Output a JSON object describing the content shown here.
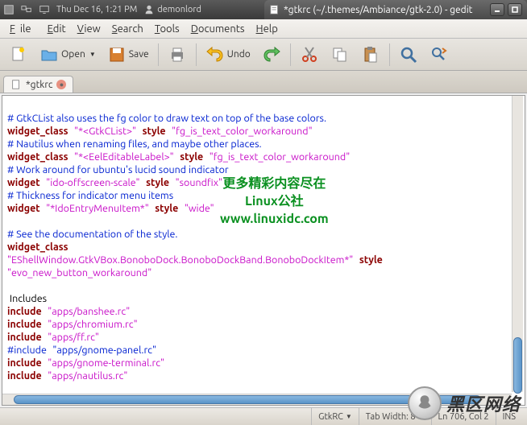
{
  "panel": {
    "date": "Thu Dec 16, 1:21 PM",
    "user": "demonlord"
  },
  "window": {
    "title": "*gtkrc (~/.themes/Ambiance/gtk-2.0) - gedit"
  },
  "menu": {
    "file": "File",
    "edit": "Edit",
    "view": "View",
    "search": "Search",
    "tools": "Tools",
    "documents": "Documents",
    "help": "Help"
  },
  "toolbar": {
    "open": "Open",
    "save": "Save",
    "undo": "Undo"
  },
  "tab": {
    "name": "*gtkrc"
  },
  "code": {
    "l1": "# GtkCList also uses the fg color to draw text on top of the base colors.",
    "l2a": "widget_class",
    "l2b": "\"*<GtkCList>\"",
    "l2c": "style",
    "l2d": "\"fg_is_text_color_workaround\"",
    "l3": "# Nautilus when renaming files, and maybe other places.",
    "l4a": "widget_class",
    "l4b": "\"*<EelEditableLabel>\"",
    "l4c": "style",
    "l4d": "\"fg_is_text_color_workaround\"",
    "l5": "# Work around for ubuntu's lucid sound indicator",
    "l6a": "widget",
    "l6b": "\"ido-offscreen-scale\"",
    "l6c": "style",
    "l6d": "\"soundfix\"",
    "l7": "# Thickness for indicator menu items",
    "l8a": "widget",
    "l8b": "\"*IdoEntryMenuItem*\"",
    "l8c": "style",
    "l8d": "\"wide\"",
    "l9": "",
    "l10": "# See the documentation of the style.",
    "l11a": "widget_class",
    "l12a": "\"EShellWindow.GtkVBox.BonoboDock.BonoboDockBand.BonoboDockItem*\"",
    "l12b": "style",
    "l13a": "\"evo_new_button_workaround\"",
    "l14": "",
    "l15": " Includes",
    "l16a": "include",
    "l16b": "\"apps/banshee.rc\"",
    "l17a": "include",
    "l17b": "\"apps/chromium.rc\"",
    "l18a": "include",
    "l18b": "\"apps/ff.rc\"",
    "l19a": "#include",
    "l19b": "\"apps/gnome-panel.rc\"",
    "l20a": "include",
    "l20b": "\"apps/gnome-terminal.rc\"",
    "l21a": "include",
    "l21b": "\"apps/nautilus.rc\""
  },
  "watermark": {
    "line1": "更多精彩内容尽在",
    "line2": "Linux公社",
    "line3": "www.linuxidc.com"
  },
  "status": {
    "lang": "GtkRC",
    "tab": "Tab Width: 8",
    "pos": "Ln 706, Col 2",
    "ins": "INS"
  },
  "logo": "黑区网络"
}
